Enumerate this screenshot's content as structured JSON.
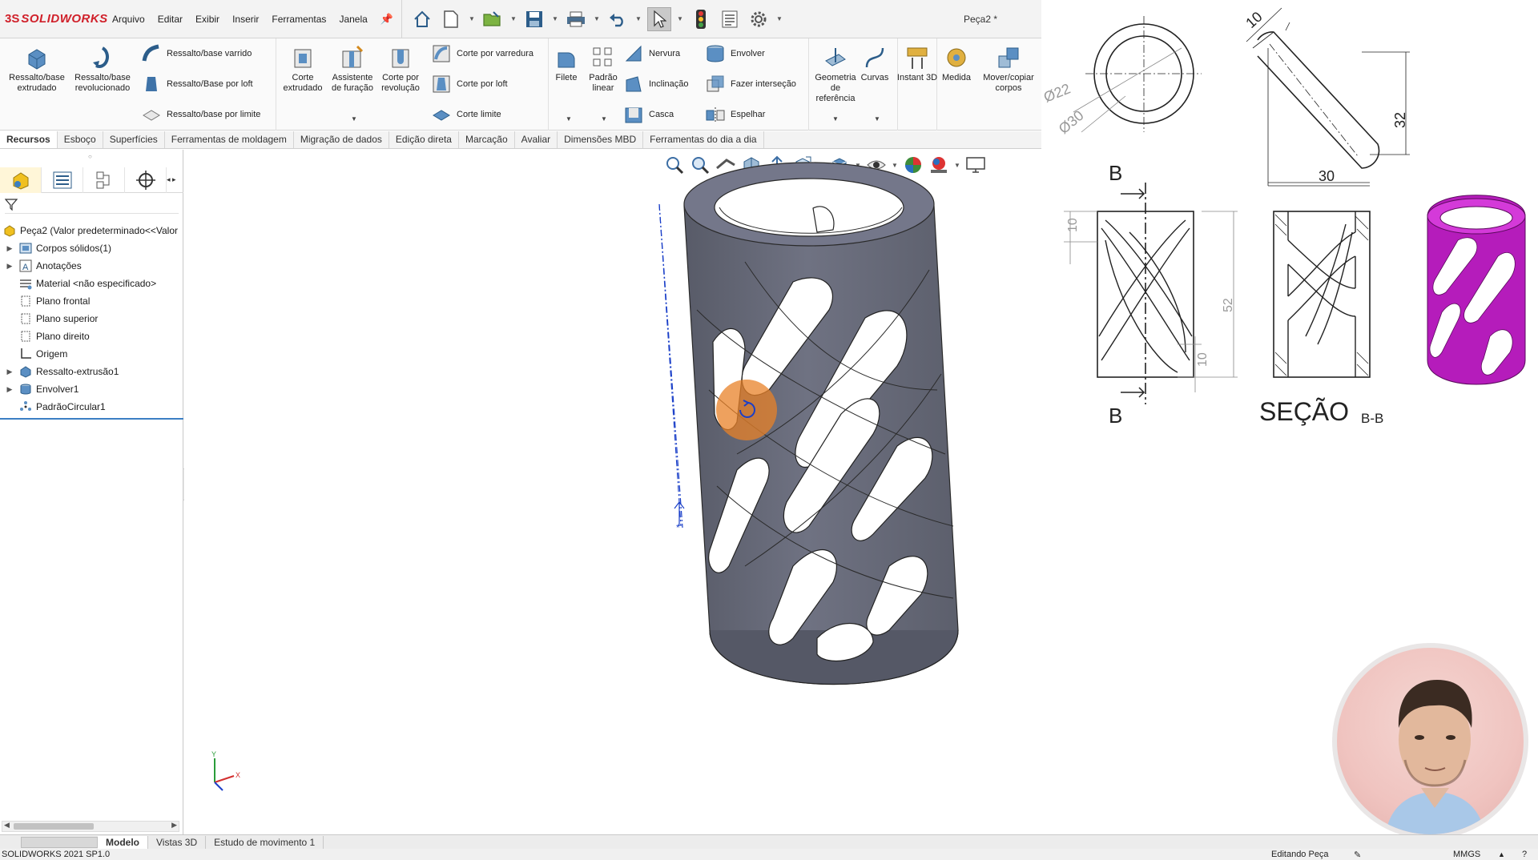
{
  "app": {
    "logo_ds": "3S",
    "logo_text": "SOLIDWORKS",
    "document_title": "Peça2 *"
  },
  "menu": [
    "Arquivo",
    "Editar",
    "Exibir",
    "Inserir",
    "Ferramentas",
    "Janela"
  ],
  "ribbon": {
    "extrude_boss": "Ressalto/base extrudado",
    "revolve_boss": "Ressalto/base revolucionado",
    "swept_boss": "Ressalto/base varrido",
    "loft_boss": "Ressalto/Base por loft",
    "boundary_boss": "Ressalto/base por limite",
    "extruded_cut": "Corte extrudado",
    "hole_wizard": "Assistente de furação",
    "revolved_cut": "Corte por revolução",
    "swept_cut": "Corte por varredura",
    "lofted_cut": "Corte por loft",
    "boundary_cut": "Corte limite",
    "fillet": "Filete",
    "linear_pattern": "Padrão linear",
    "rib": "Nervura",
    "draft": "Inclinação",
    "shell": "Casca",
    "wrap": "Envolver",
    "intersect": "Fazer interseção",
    "mirror": "Espelhar",
    "ref_geometry": "Geometria de referência",
    "curves": "Curvas",
    "instant3d": "Instant 3D",
    "measure": "Medida",
    "move_copy": "Mover/copiar corpos"
  },
  "tabs": [
    "Recursos",
    "Esboço",
    "Superfícies",
    "Ferramentas de moldagem",
    "Migração de dados",
    "Edição direta",
    "Marcação",
    "Avaliar",
    "Dimensões MBD",
    "Ferramentas do dia a dia"
  ],
  "tree": {
    "root": "Peça2  (Valor predeterminado<<Valor",
    "items": [
      {
        "label": "Corpos sólidos(1)",
        "expandable": true
      },
      {
        "label": "Anotações",
        "expandable": true
      },
      {
        "label": "Material <não especificado>",
        "expandable": false
      },
      {
        "label": "Plano frontal",
        "expandable": false
      },
      {
        "label": "Plano superior",
        "expandable": false
      },
      {
        "label": "Plano direito",
        "expandable": false
      },
      {
        "label": "Origem",
        "expandable": false
      },
      {
        "label": "Ressalto-extrusão1",
        "expandable": true
      },
      {
        "label": "Envolver1",
        "expandable": true
      },
      {
        "label": "PadrãoCircular1",
        "expandable": false
      }
    ]
  },
  "bottom_tabs": [
    "Modelo",
    "Vistas 3D",
    "Estudo de movimento 1"
  ],
  "status": {
    "version": "SOLIDWORKS 2021 SP1.0",
    "editing": "Editando Peça",
    "units": "MMGS"
  },
  "drawing": {
    "dim_phi22": "Ø22",
    "dim_phi30": "Ø30",
    "dim_10_top": "10",
    "dim_32": "32",
    "dim_30": "30",
    "section_mark_top": "B",
    "section_mark_bottom": "B",
    "dim_10_left": "10",
    "dim_52": "52",
    "dim_10_right": "10",
    "section_title": "SEÇÃO",
    "section_sub": "B-B"
  },
  "colors": {
    "brand_red": "#d0202a",
    "model_gray": "#6e7180",
    "reference_magenta": "#c21ec8",
    "highlight_orange": "#e88228"
  }
}
